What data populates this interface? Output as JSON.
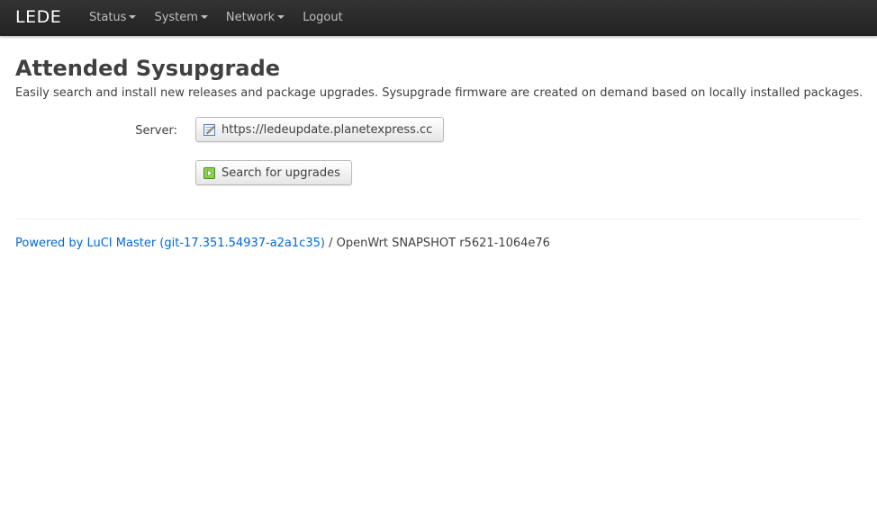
{
  "header": {
    "brand": "LEDE",
    "nav": [
      {
        "label": "Status",
        "dropdown": true
      },
      {
        "label": "System",
        "dropdown": true
      },
      {
        "label": "Network",
        "dropdown": true
      },
      {
        "label": "Logout",
        "dropdown": false
      }
    ]
  },
  "main": {
    "title": "Attended Sysupgrade",
    "description": "Easily search and install new releases and package upgrades. Sysupgrade firmware are created on demand based on locally installed packages.",
    "server_label": "Server:",
    "server_value": "https://ledeupdate.planetexpress.cc",
    "server_icon": "edit-icon",
    "search_button_label": "Search for upgrades",
    "search_icon": "play-icon"
  },
  "footer": {
    "powered_by": "Powered by LuCI Master (git-17.351.54937-a2a1c35)",
    "separator": " / ",
    "version": "OpenWrt SNAPSHOT r5621-1064e76"
  },
  "colors": {
    "topbar": "#222222",
    "link": "#0069d6",
    "text": "#404040"
  }
}
